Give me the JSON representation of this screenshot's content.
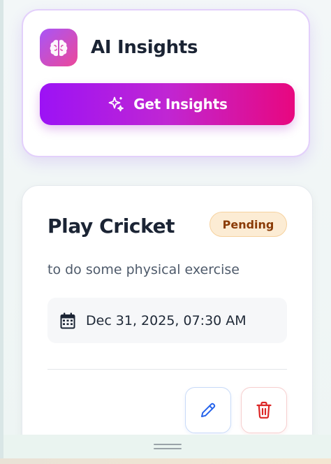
{
  "ai_card": {
    "title": "AI Insights",
    "icon": "brain-icon",
    "button_label": "Get Insights",
    "button_icon": "sparkles-icon"
  },
  "task": {
    "title": "Play Cricket",
    "status": "Pending",
    "description": "to do some physical exercise",
    "date_icon": "calendar-icon",
    "datetime": "Dec 31, 2025, 07:30 AM",
    "actions": {
      "edit_icon": "pencil-icon",
      "delete_icon": "trash-icon"
    }
  },
  "colors": {
    "accent_start": "#9c12f5",
    "accent_end": "#e8077f",
    "pending_bg": "#fcecd4",
    "pending_text": "#8a3b06",
    "edit_blue": "#2563eb",
    "delete_red": "#dc2626"
  }
}
